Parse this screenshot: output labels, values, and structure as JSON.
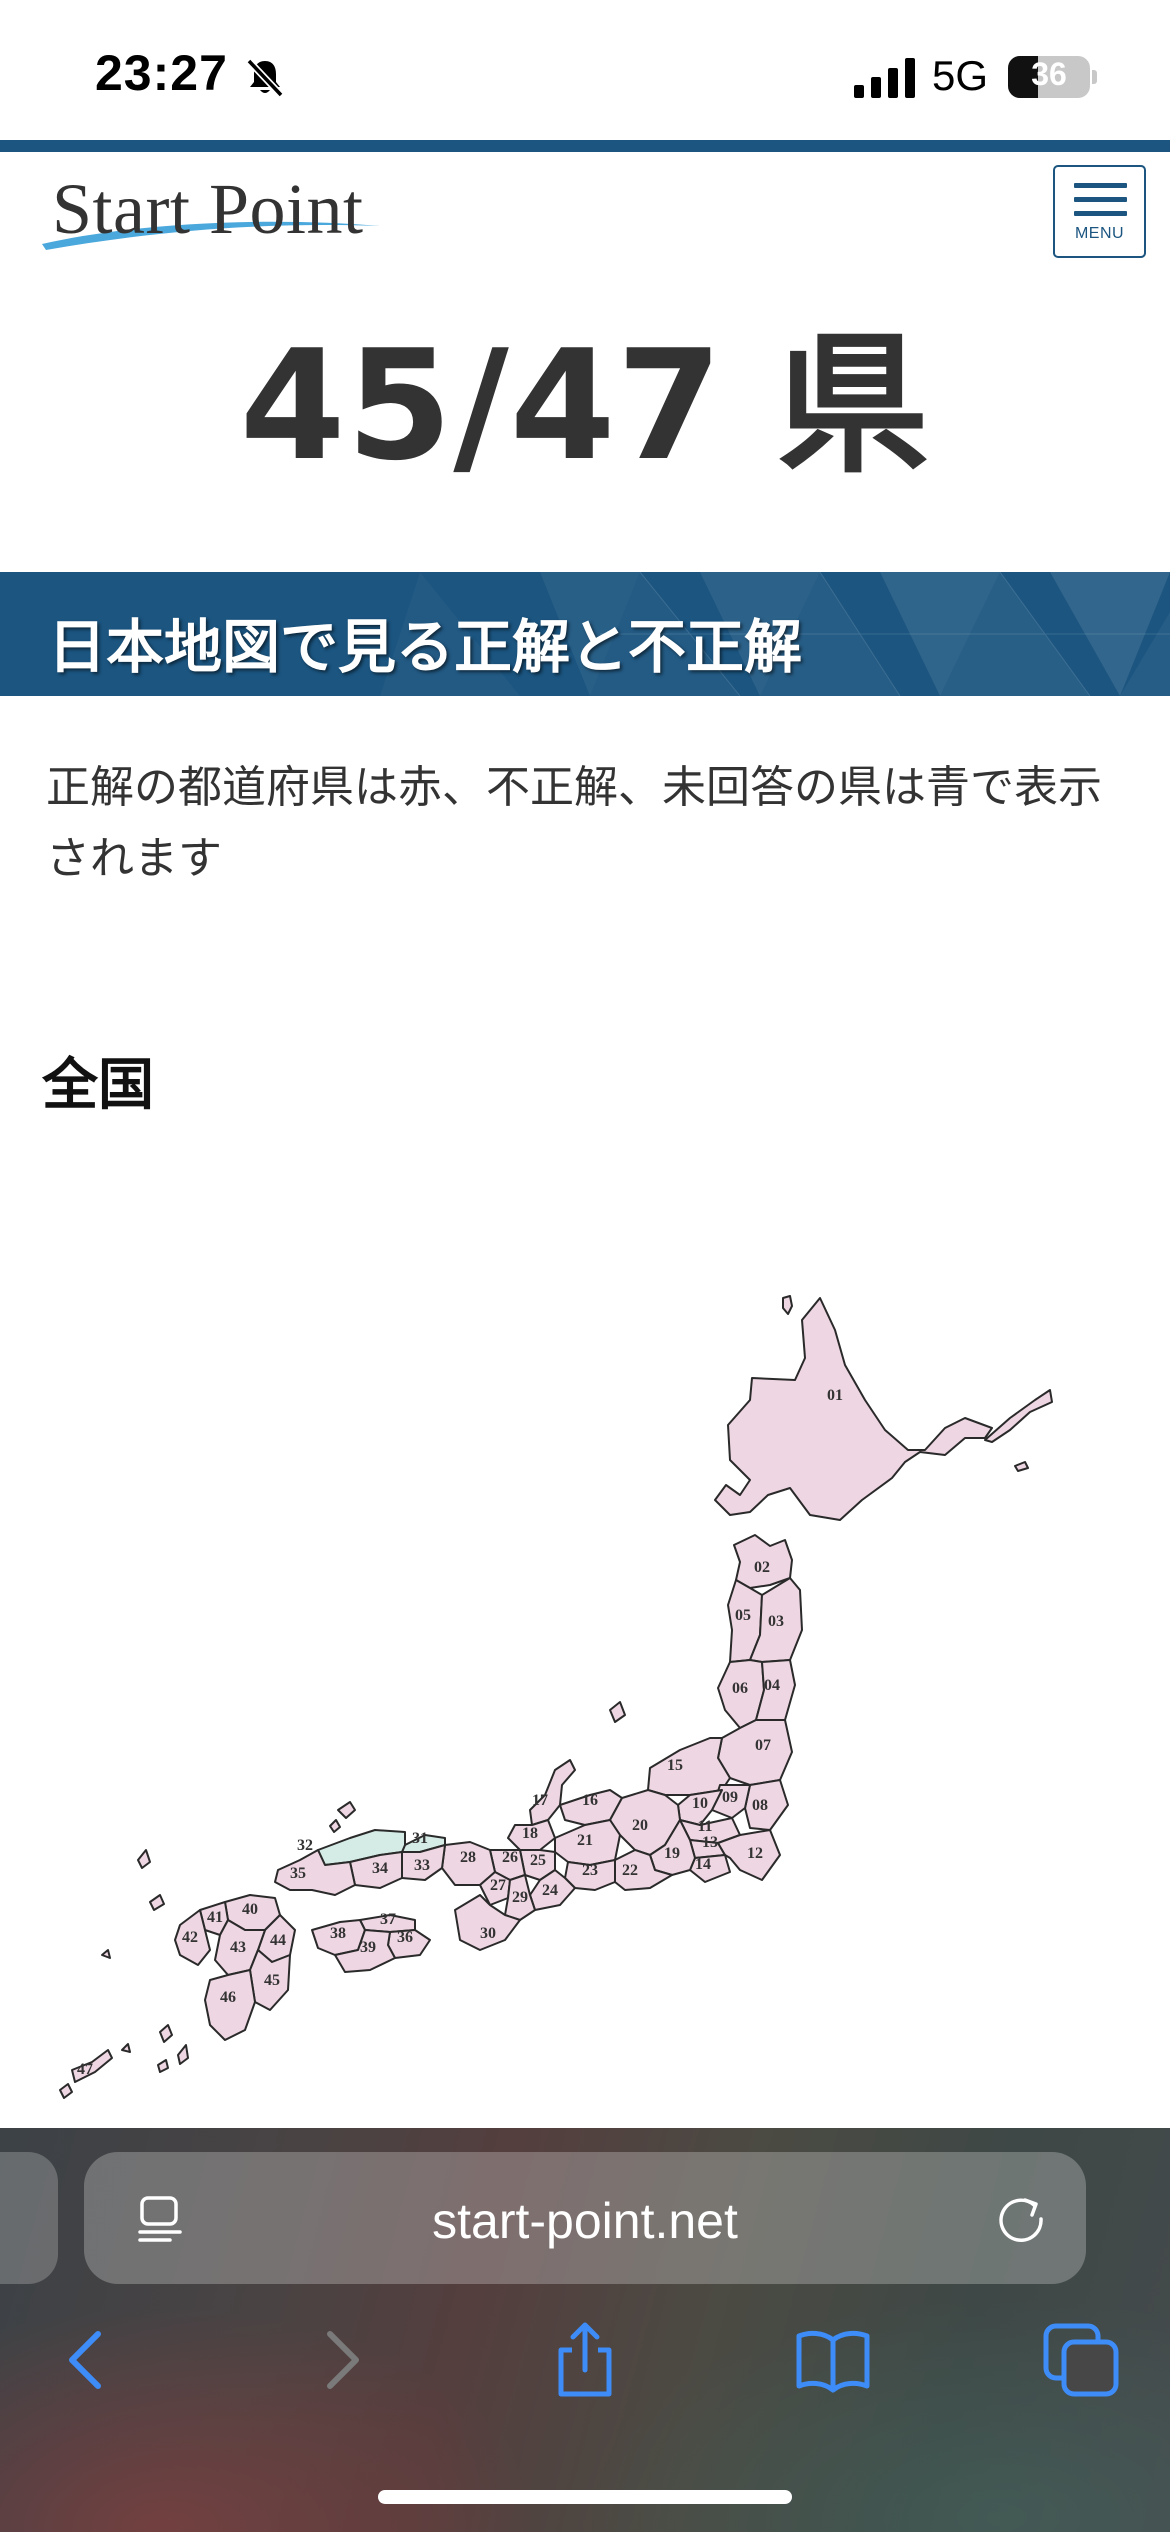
{
  "status_bar": {
    "time": "23:27",
    "network": "5G",
    "battery_percent": 36,
    "battery_text": "36",
    "icons": [
      "bell-slash-icon",
      "cellular-signal-icon",
      "battery-icon"
    ]
  },
  "header": {
    "logo_text": "Start Point",
    "menu_label": "MENU",
    "accent_color": "#1b5580",
    "swoosh_color": "#4aa8dc"
  },
  "result": {
    "score": "45/47 県"
  },
  "section": {
    "title": "日本地図で見る正解と不正解",
    "description": "正解の都道府県は赤、不正解、未回答の県は青で表示されます"
  },
  "map": {
    "heading": "全国",
    "correct_color": "#eed6e2",
    "incorrect_color": "#d5ece6",
    "labels": [
      "01",
      "02",
      "03",
      "04",
      "05",
      "06",
      "07",
      "08",
      "09",
      "10",
      "11",
      "12",
      "13",
      "14",
      "15",
      "16",
      "17",
      "18",
      "19",
      "20",
      "21",
      "22",
      "23",
      "24",
      "25",
      "26",
      "27",
      "28",
      "29",
      "30",
      "31",
      "32",
      "33",
      "34",
      "35",
      "36",
      "37",
      "38",
      "39",
      "40",
      "41",
      "42",
      "43",
      "44",
      "45",
      "46",
      "47"
    ]
  },
  "browser": {
    "url": "start-point.net",
    "icons": [
      "reader-icon",
      "reload-icon",
      "back-icon",
      "forward-icon",
      "share-icon",
      "bookmarks-icon",
      "tabs-icon"
    ]
  }
}
